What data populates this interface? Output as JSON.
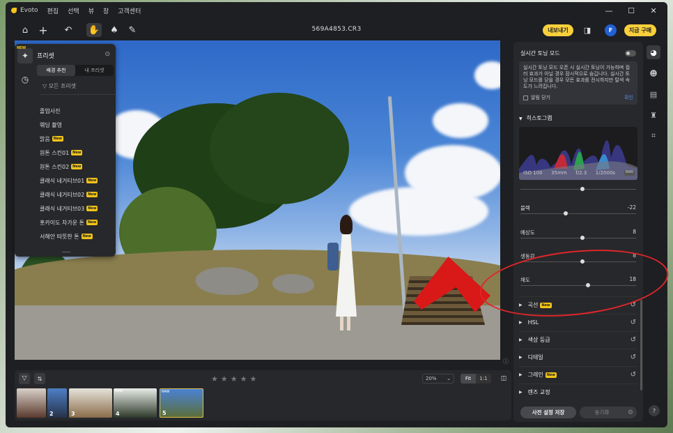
{
  "app": {
    "name": "Evoto",
    "menu": [
      "편집",
      "선택",
      "뷰",
      "창",
      "고객센터"
    ],
    "window_controls": [
      "—",
      "☐",
      "✕"
    ]
  },
  "toolbar": {
    "filename": "569A4853.CR3",
    "export_label": "내보내기",
    "account_initial": "F",
    "buy_label": "지금 구매",
    "accent": "#f7d03c"
  },
  "preset_panel": {
    "title": "프리셋",
    "new_badge": "NEW",
    "tabs": [
      "배경 추천",
      "내 프리셋"
    ],
    "filter_label": "모든 프리셋",
    "items": [
      {
        "label": "졸업사진",
        "is_new": false
      },
      {
        "label": "웨딩 촬영",
        "is_new": false
      },
      {
        "label": "밝음",
        "is_new": true
      },
      {
        "label": "원톤 스킨01",
        "is_new": true
      },
      {
        "label": "원톤 스킨02",
        "is_new": true
      },
      {
        "label": "클래식 네거티브01",
        "is_new": true
      },
      {
        "label": "클래식 네거티브02",
        "is_new": true
      },
      {
        "label": "클래식 네거티브03",
        "is_new": true
      },
      {
        "label": "홋카이도 차가운 톤",
        "is_new": true
      },
      {
        "label": "서해안 따뜻한 톤",
        "is_new": true
      }
    ],
    "new_tag": "New"
  },
  "filmstrip": {
    "zoom": "20%",
    "fit_label": "Fit",
    "one_to_one": "1:1",
    "stars": 5,
    "thumbs": [
      {
        "num": "",
        "raw": ""
      },
      {
        "num": "2",
        "raw": ""
      },
      {
        "num": "3",
        "raw": ""
      },
      {
        "num": "4",
        "raw": "RAW"
      },
      {
        "num": "5",
        "raw": "RAW"
      }
    ]
  },
  "right_panel": {
    "realtime_title": "실시간 토닝 모드",
    "info_text": "실시간 토닝 모드 오픈 시 실시간 토닝이 가능하며 컬러 효과가 아닐 경우 잠시적으로 숨깁니다. 실시간 토닝 모드를 닫을 경우 모든 효과를 전시하지만 탈색 속도가 느려집니다.",
    "hide_label": "알림 닫기",
    "confirm_label": "확인",
    "histogram_title": "히스토그램",
    "exif": {
      "iso": "ISO 100",
      "focal": "35mm",
      "aperture": "f/2.3",
      "shutter": "1/2000s",
      "format": "RAW"
    },
    "sliders": [
      {
        "label": "블랙",
        "value": "-22",
        "level": 0.39
      },
      {
        "label": "예상도",
        "value": "8",
        "level": 0.54
      },
      {
        "label": "생동감",
        "value": "8",
        "level": 0.54
      },
      {
        "label": "채도",
        "value": "18",
        "level": 0.59
      }
    ],
    "sections": [
      {
        "label": "곡선",
        "is_new": true
      },
      {
        "label": "HSL",
        "is_new": false
      },
      {
        "label": "색상 등급",
        "is_new": false
      },
      {
        "label": "디테일",
        "is_new": false
      },
      {
        "label": "그레인",
        "is_new": true
      },
      {
        "label": "렌즈 교정",
        "is_new": false
      }
    ],
    "save_label": "사전 설정 저장",
    "sync_label": "동기화"
  },
  "help_label": "?"
}
